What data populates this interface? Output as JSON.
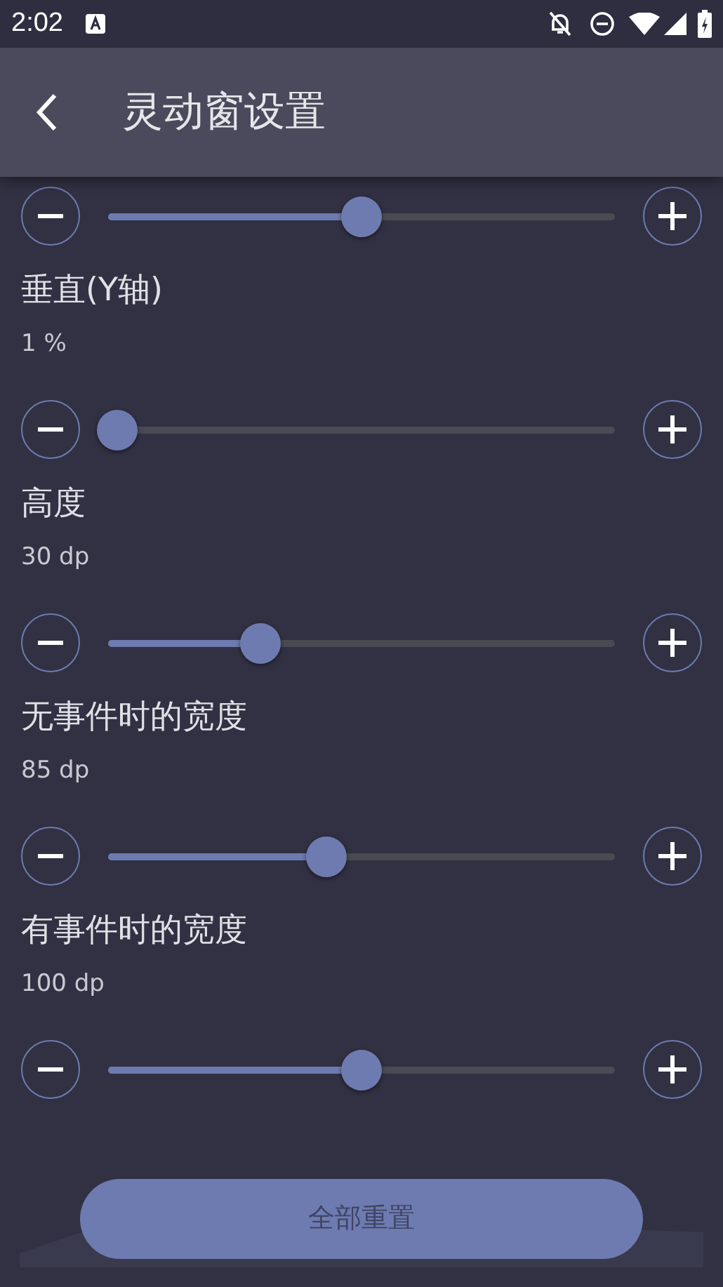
{
  "status_bar": {
    "time": "2:02"
  },
  "app_bar": {
    "title": "灵动窗设置"
  },
  "settings": [
    {
      "level": 0.5
    },
    {
      "label": "垂直(Y轴)",
      "value": "1 %",
      "level": 0.017
    },
    {
      "label": "高度",
      "value": "30 dp",
      "level": 0.3
    },
    {
      "label": "无事件时的宽度",
      "value": "85 dp",
      "level": 0.43
    },
    {
      "label": "有事件时的宽度",
      "value": "100 dp",
      "level": 0.5
    }
  ],
  "reset_button": {
    "label": "全部重置"
  }
}
